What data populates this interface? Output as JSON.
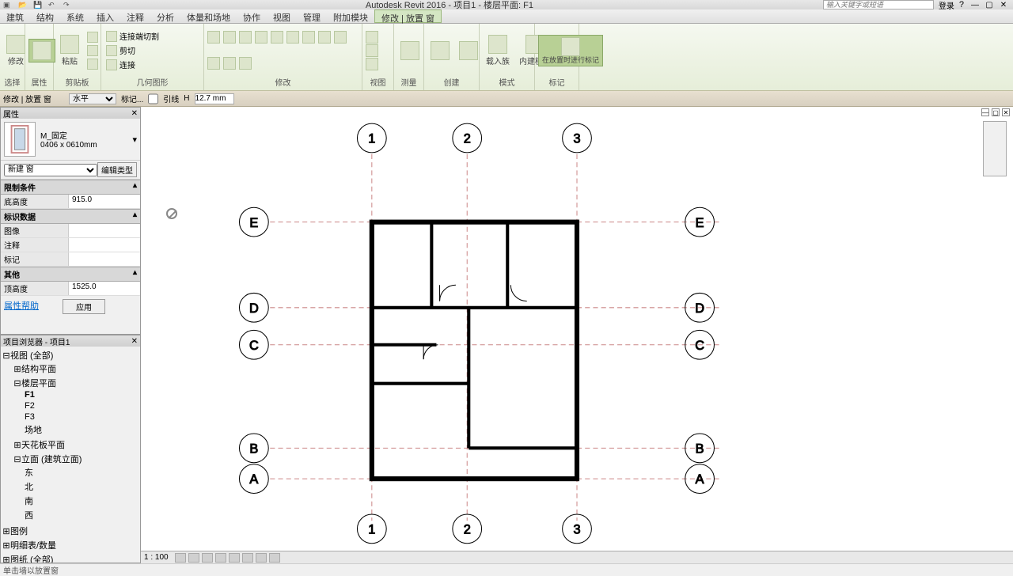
{
  "app": {
    "title": "Autodesk Revit 2016 - 项目1 - 楼层平面: F1",
    "search_placeholder": "输入关键字或短语",
    "sign_in": "登录"
  },
  "menu": [
    "建筑",
    "结构",
    "系统",
    "插入",
    "注释",
    "分析",
    "体量和场地",
    "协作",
    "视图",
    "管理",
    "附加模块",
    "修改 | 放置 窗"
  ],
  "ribbon": {
    "select": "选择",
    "modify": "修改",
    "props": "属性",
    "paste": "粘贴",
    "clipboard": "剪贴板",
    "join_end": "连接端切割",
    "cut": "剪切",
    "join": "连接",
    "geom": "几何图形",
    "modify_panel": "修改",
    "view": "视图",
    "measure": "测量",
    "create": "创建",
    "load_family": "载入族",
    "inplace": "内建模型",
    "mode": "模式",
    "tag_on_place": "在放置时进行标记",
    "tag": "标记"
  },
  "optbar": {
    "label1": "修改 | 放置 窗",
    "orient": "水平",
    "tag": "标记...",
    "lead": "引线",
    "dist": "12.7 mm"
  },
  "props": {
    "panel_title": "属性",
    "family_name": "M_固定",
    "type_name": "0406 x 0610mm",
    "selector": "新建 窗",
    "edit_type": "编辑类型",
    "cat_constraint": "限制条件",
    "sill_height": "底高度",
    "sill_height_v": "915.0",
    "cat_identity": "标识数据",
    "image": "图像",
    "comments": "注释",
    "mark": "标记",
    "cat_other": "其他",
    "head_height": "顶高度",
    "head_height_v": "1525.0",
    "help": "属性帮助",
    "apply": "应用"
  },
  "browser": {
    "title": "项目浏览器 - 项目1",
    "views": "视图 (全部)",
    "struct_plan": "结构平面",
    "floor_plan": "楼层平面",
    "f1": "F1",
    "f2": "F2",
    "f3": "F3",
    "site": "场地",
    "ceiling_plan": "天花板平面",
    "elev": "立面 (建筑立面)",
    "east": "东",
    "north": "北",
    "south": "南",
    "west": "西",
    "legend": "图例",
    "schedule": "明细表/数量",
    "sheets": "图纸 (全部)"
  },
  "grids_v": [
    "1",
    "2",
    "3"
  ],
  "grids_h": [
    "E",
    "D",
    "C",
    "B",
    "A"
  ],
  "status": {
    "scale": "1 : 100"
  },
  "footer": "单击墙以放置窗"
}
